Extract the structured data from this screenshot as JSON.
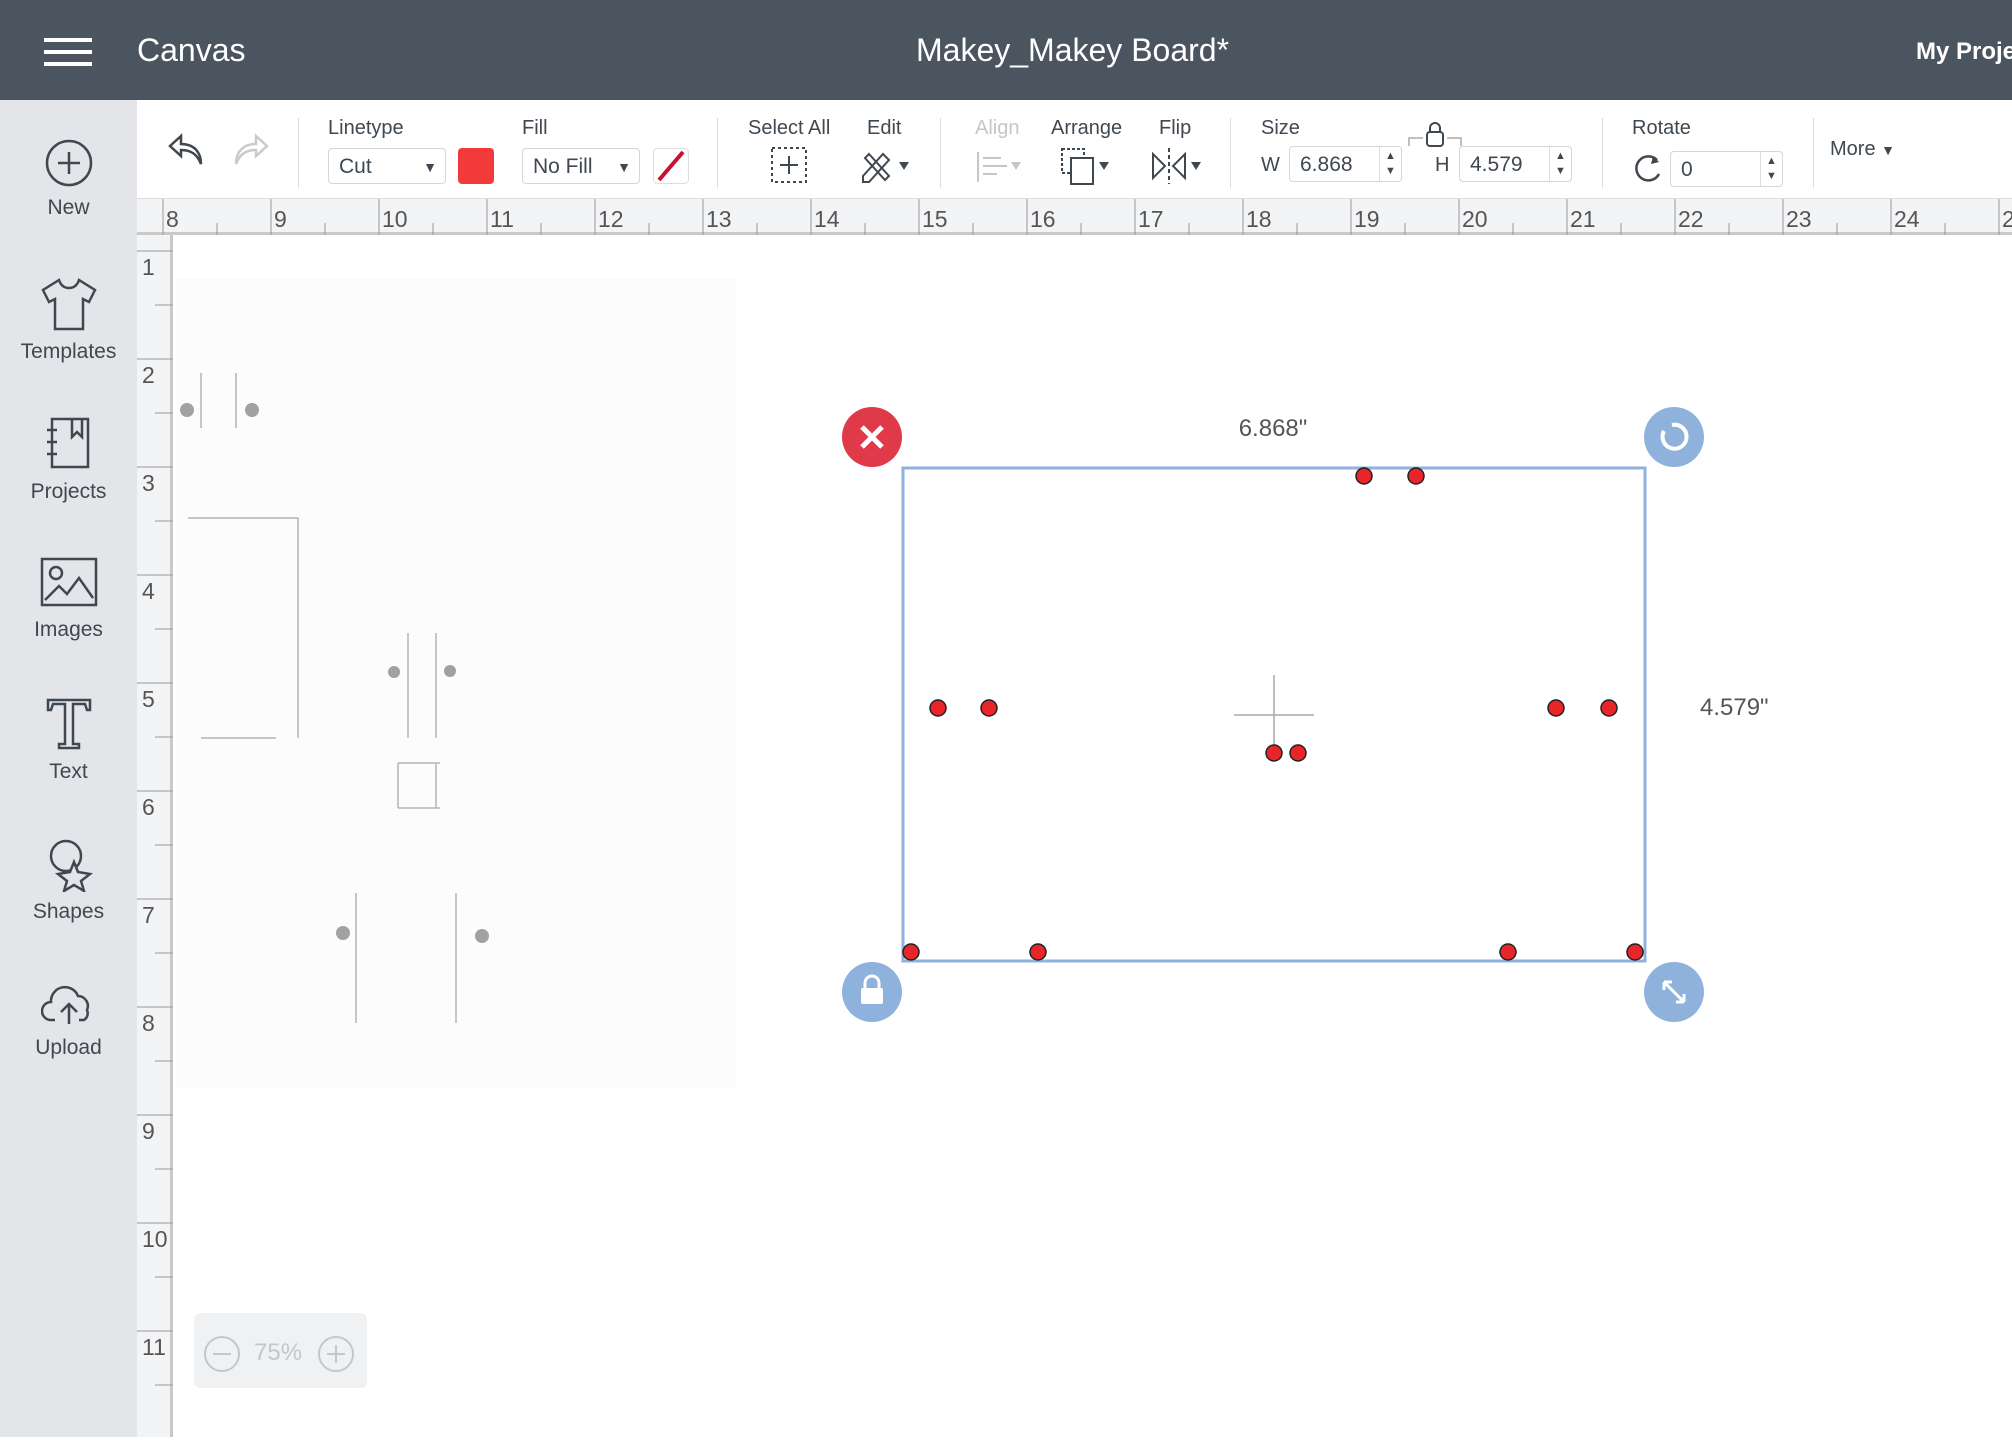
{
  "header": {
    "menu_icon": "hamburger-icon",
    "app_name": "Canvas",
    "project_title": "Makey_Makey Board*",
    "my_projects": "My Proje"
  },
  "sidebar": {
    "items": [
      {
        "label": "New",
        "icon": "plus-circle-icon"
      },
      {
        "label": "Templates",
        "icon": "tshirt-icon"
      },
      {
        "label": "Projects",
        "icon": "notebook-icon"
      },
      {
        "label": "Images",
        "icon": "image-icon"
      },
      {
        "label": "Text",
        "icon": "text-icon"
      },
      {
        "label": "Shapes",
        "icon": "shapes-icon"
      },
      {
        "label": "Upload",
        "icon": "cloud-upload-icon"
      }
    ]
  },
  "toolbar": {
    "linetype_label": "Linetype",
    "linetype_value": "Cut",
    "linetype_color": "#f23a3a",
    "fill_label": "Fill",
    "fill_value": "No Fill",
    "select_all_label": "Select All",
    "edit_label": "Edit",
    "align_label": "Align",
    "arrange_label": "Arrange",
    "flip_label": "Flip",
    "size_label": "Size",
    "w_label": "W",
    "w_value": "6.868",
    "h_label": "H",
    "h_value": "4.579",
    "rotate_label": "Rotate",
    "rotate_value": "0",
    "more_label": "More"
  },
  "ruler": {
    "h_labels": [
      "8",
      "9",
      "10",
      "11",
      "12",
      "13",
      "14",
      "15",
      "16",
      "17",
      "18",
      "19",
      "20",
      "21",
      "22",
      "23",
      "24",
      "2"
    ],
    "v_labels": [
      "1",
      "2",
      "3",
      "4",
      "5",
      "6",
      "7",
      "8",
      "9",
      "10",
      "11"
    ]
  },
  "canvas": {
    "width_label": "6.868\"",
    "height_label": "4.579\"",
    "selection_color": "#8fb2dc",
    "dot_color": "#e8262a",
    "delete_color": "#e03a4a"
  },
  "zoom": {
    "value": "75%"
  }
}
